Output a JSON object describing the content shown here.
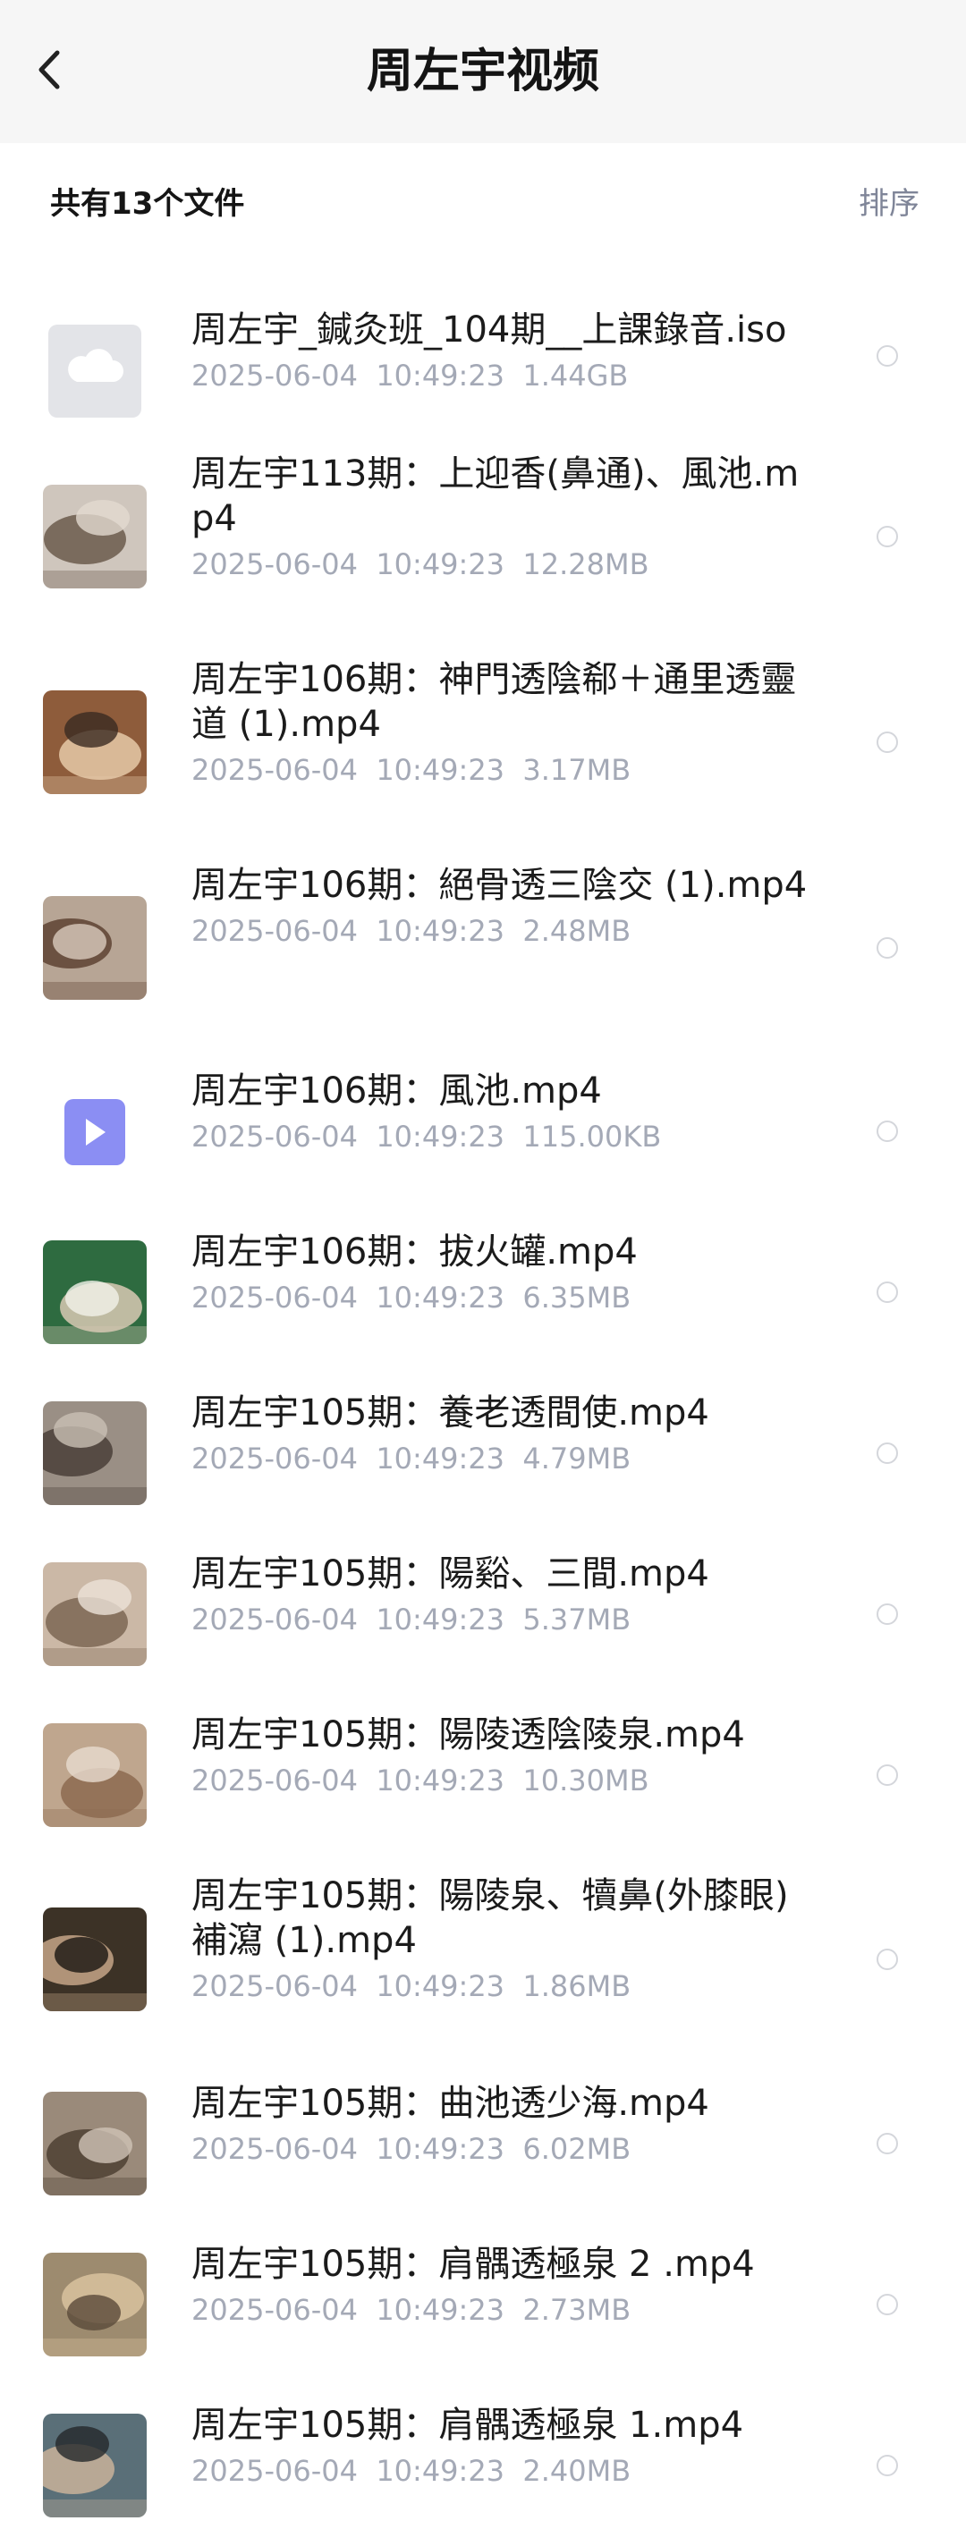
{
  "header": {
    "back_icon": "chevron-left-icon",
    "title": "周左宇视频"
  },
  "summary": {
    "file_count_text": "共有13个文件",
    "sort_label": "排序"
  },
  "colors": {
    "header_bg": "#f6f6f6",
    "meta_text": "#a4a9b6",
    "video_icon": "#8b8ef3",
    "cloud_icon": "#e3e4e8"
  },
  "files": [
    {
      "name": "周左宇_鍼灸班_104期__上課錄音.iso",
      "date": "2025-06-04",
      "time": "10:49:23",
      "size": "1.44GB",
      "icon": "cloud-file-icon"
    },
    {
      "name": "周左宇113期：上迎香(鼻通)、風池.mp4",
      "date": "2025-06-04",
      "time": "10:49:23",
      "size": "12.28MB",
      "icon": "video-thumbnail"
    },
    {
      "name": "周左宇106期：神門透陰郗＋通里透靈道 (1).mp4",
      "date": "2025-06-04",
      "time": "10:49:23",
      "size": "3.17MB",
      "icon": "video-thumbnail"
    },
    {
      "name": "周左宇106期：絕骨透三陰交 (1).mp4",
      "date": "2025-06-04",
      "time": "10:49:23",
      "size": "2.48MB",
      "icon": "video-thumbnail"
    },
    {
      "name": "周左宇106期：風池.mp4",
      "date": "2025-06-04",
      "time": "10:49:23",
      "size": "115.00KB",
      "icon": "video-file-icon"
    },
    {
      "name": "周左宇106期：拔火罐.mp4",
      "date": "2025-06-04",
      "time": "10:49:23",
      "size": "6.35MB",
      "icon": "video-thumbnail"
    },
    {
      "name": "周左宇105期：養老透間使.mp4",
      "date": "2025-06-04",
      "time": "10:49:23",
      "size": "4.79MB",
      "icon": "video-thumbnail"
    },
    {
      "name": "周左宇105期：陽谿、三間.mp4",
      "date": "2025-06-04",
      "time": "10:49:23",
      "size": "5.37MB",
      "icon": "video-thumbnail"
    },
    {
      "name": "周左宇105期：陽陵透陰陵泉.mp4",
      "date": "2025-06-04",
      "time": "10:49:23",
      "size": "10.30MB",
      "icon": "video-thumbnail"
    },
    {
      "name": "周左宇105期：陽陵泉、犢鼻(外膝眼)補瀉 (1).mp4",
      "date": "2025-06-04",
      "time": "10:49:23",
      "size": "1.86MB",
      "icon": "video-thumbnail"
    },
    {
      "name": "周左宇105期：曲池透少海.mp4",
      "date": "2025-06-04",
      "time": "10:49:23",
      "size": "6.02MB",
      "icon": "video-thumbnail"
    },
    {
      "name": "周左宇105期：肩髃透極泉 2 .mp4",
      "date": "2025-06-04",
      "time": "10:49:23",
      "size": "2.73MB",
      "icon": "video-thumbnail"
    },
    {
      "name": "周左宇105期：肩髃透極泉 1.mp4",
      "date": "2025-06-04",
      "time": "10:49:23",
      "size": "2.40MB",
      "icon": "video-thumbnail"
    }
  ]
}
